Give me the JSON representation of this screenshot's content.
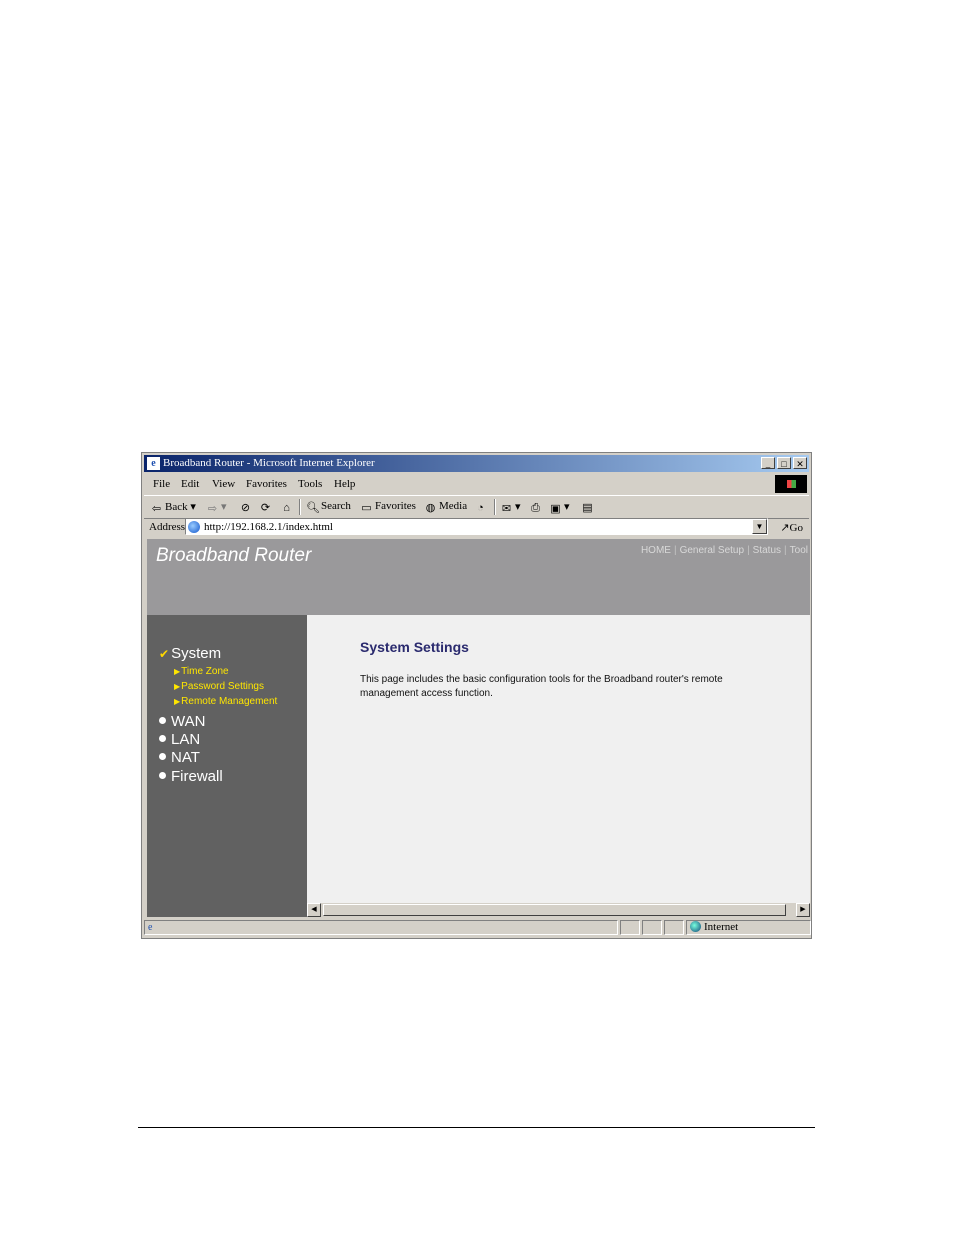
{
  "browser": {
    "title": "Broadband Router - Microsoft Internet Explorer",
    "menu": [
      "File",
      "Edit",
      "View",
      "Favorites",
      "Tools",
      "Help"
    ],
    "toolbar": {
      "back": "Back",
      "search": "Search",
      "favorites": "Favorites",
      "media": "Media"
    },
    "address_label": "Address",
    "url": "http://192.168.2.1/index.html",
    "go": "Go",
    "status_zone": "Internet"
  },
  "page": {
    "brand": "Broadband Router",
    "topnav": [
      "HOME",
      "General Setup",
      "Status",
      "Tool"
    ],
    "sidebar": {
      "active": "System",
      "sub_items": [
        "Time Zone",
        "Password Settings",
        "Remote Management"
      ],
      "items": [
        "WAN",
        "LAN",
        "NAT",
        "Firewall"
      ]
    },
    "main": {
      "title": "System Settings",
      "description": "This page includes the basic configuration tools for the Broadband router's remote management access function."
    }
  },
  "colors": {
    "banner": "#9a999b",
    "sidebar": "#616161",
    "submenu": "#ffe600",
    "heading": "#2a2a6e"
  }
}
